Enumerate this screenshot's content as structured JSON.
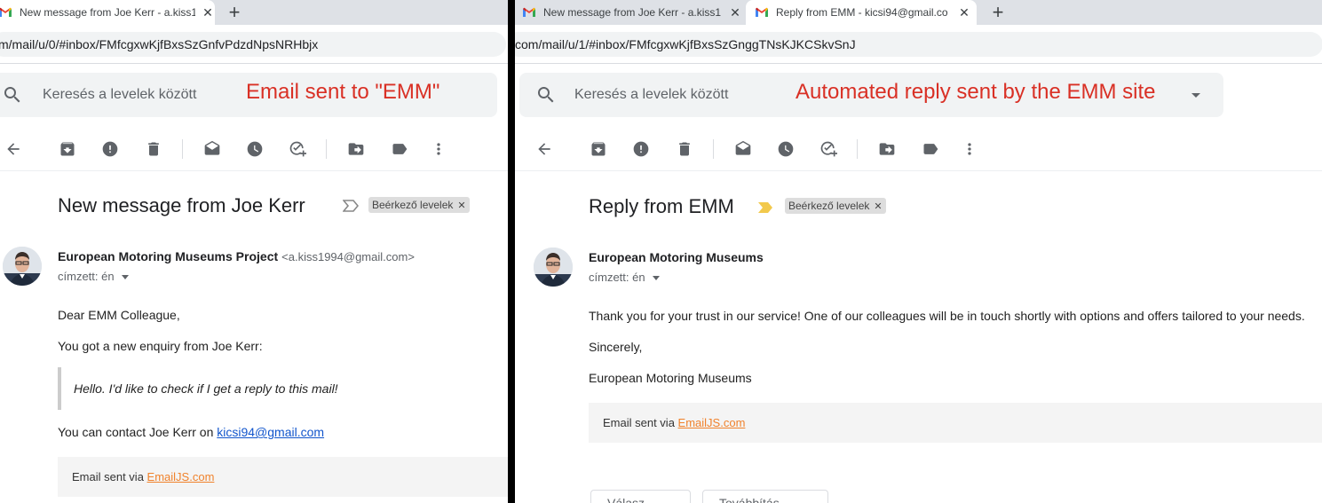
{
  "left": {
    "tab": {
      "title": "New message from Joe Kerr - a.kiss1"
    },
    "url": "m/mail/u/0/#inbox/FMfcgxwKjfBxsSzGnfvPdzdNpsNRHbjx",
    "search_placeholder": "Keresés a levelek között",
    "annotation": "Email sent to \"EMM\"",
    "subject": "New message from Joe Kerr",
    "label": "Beérkező levelek",
    "sender_name": "European Motoring Museums Project",
    "sender_email": "<a.kiss1994@gmail.com>",
    "to": "címzett: én",
    "body": {
      "greeting": "Dear EMM Colleague,",
      "line1": "You got a new enquiry from Joe Kerr:",
      "quote": "Hello. I'd like to check if I get a reply to this mail!",
      "contact_prefix": "You can contact Joe Kerr on ",
      "contact_email": "kicsi94@gmail.com"
    },
    "footer_prefix": "Email sent via ",
    "footer_link": "EmailJS.com"
  },
  "right": {
    "tabs": [
      {
        "title": "New message from Joe Kerr - a.kiss1"
      },
      {
        "title": "Reply from EMM - kicsi94@gmail.co"
      }
    ],
    "url": "com/mail/u/1/#inbox/FMfcgxwKjfBxsSzGnggTNsKJKCSkvSnJ",
    "search_placeholder": "Keresés a levelek között",
    "annotation": "Automated reply sent by the EMM site",
    "subject": "Reply from EMM",
    "label": "Beérkező levelek",
    "sender_name": "European Motoring Museums",
    "to": "címzett: én",
    "body": {
      "line1": "Thank you for your trust in our service! One of our colleagues will be in touch shortly with options and offers tailored to your needs.",
      "line2": "Sincerely,",
      "line3": "European Motoring Museums"
    },
    "footer_prefix": "Email sent via ",
    "footer_link": "EmailJS.com",
    "buttons": [
      {
        "label": "Válasz"
      },
      {
        "label": "Továbbítás"
      }
    ]
  },
  "colors": {
    "annotation": "#d93025",
    "link": "#1155cc",
    "emailjs_link": "#f0822c",
    "important_marker": "#f2c94c"
  },
  "icons": [
    "search-icon",
    "back-arrow-icon",
    "archive-icon",
    "spam-icon",
    "delete-icon",
    "mark-unread-icon",
    "snooze-icon",
    "add-to-tasks-icon",
    "move-to-icon",
    "label-icon",
    "more-vert-icon",
    "important-marker-icon",
    "gmail-icon",
    "close-icon",
    "plus-icon",
    "reply-icon",
    "forward-icon"
  ]
}
